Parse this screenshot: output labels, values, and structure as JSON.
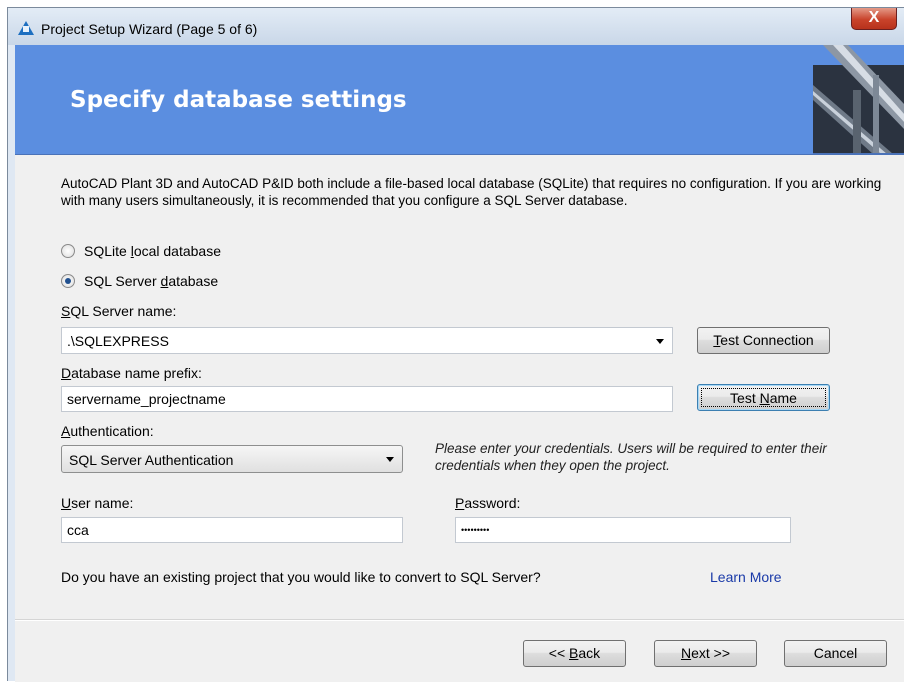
{
  "window": {
    "title": "Project Setup Wizard (Page 5 of 6)",
    "close_glyph": "X"
  },
  "banner": {
    "title": "Specify database settings"
  },
  "description": "AutoCAD Plant 3D and AutoCAD P&ID both include a file-based local database (SQLite) that requires no configuration. If you  are working with many users simultaneously, it is recommended that you configure a SQL Server database.",
  "db_type": {
    "options": [
      {
        "pre": "SQLite ",
        "ul": "l",
        "post": "ocal database",
        "checked": false
      },
      {
        "pre": "SQL Server ",
        "ul": "d",
        "post": "atabase",
        "checked": true
      }
    ]
  },
  "sql_server": {
    "label_ul": "S",
    "label_rest": "QL Server name:",
    "value": ".\\SQLEXPRESS"
  },
  "test_connection": {
    "ul": "T",
    "rest": "est Connection"
  },
  "db_prefix": {
    "label_ul": "D",
    "label_rest": "atabase name prefix:",
    "value": "servername_projectname"
  },
  "test_name": {
    "pre": "Test ",
    "ul": "N",
    "post": "ame"
  },
  "authentication": {
    "label_ul": "A",
    "label_rest": "uthentication:",
    "selected": "SQL Server Authentication",
    "note": "Please enter your credentials. Users will be required to enter their credentials when they open the project."
  },
  "username": {
    "label_ul": "U",
    "label_rest": "ser name:",
    "value": "cca"
  },
  "password": {
    "label_ul": "P",
    "label_rest": "assword:",
    "value": "•••••••••"
  },
  "convert": {
    "question": "Do you have an existing project that you would like to convert to SQL Server?",
    "learn_more": "Learn More"
  },
  "footer": {
    "back": {
      "pre": "<< ",
      "ul": "B",
      "post": "ack"
    },
    "next": {
      "ul": "N",
      "post": "ext >>"
    },
    "cancel": "Cancel"
  }
}
